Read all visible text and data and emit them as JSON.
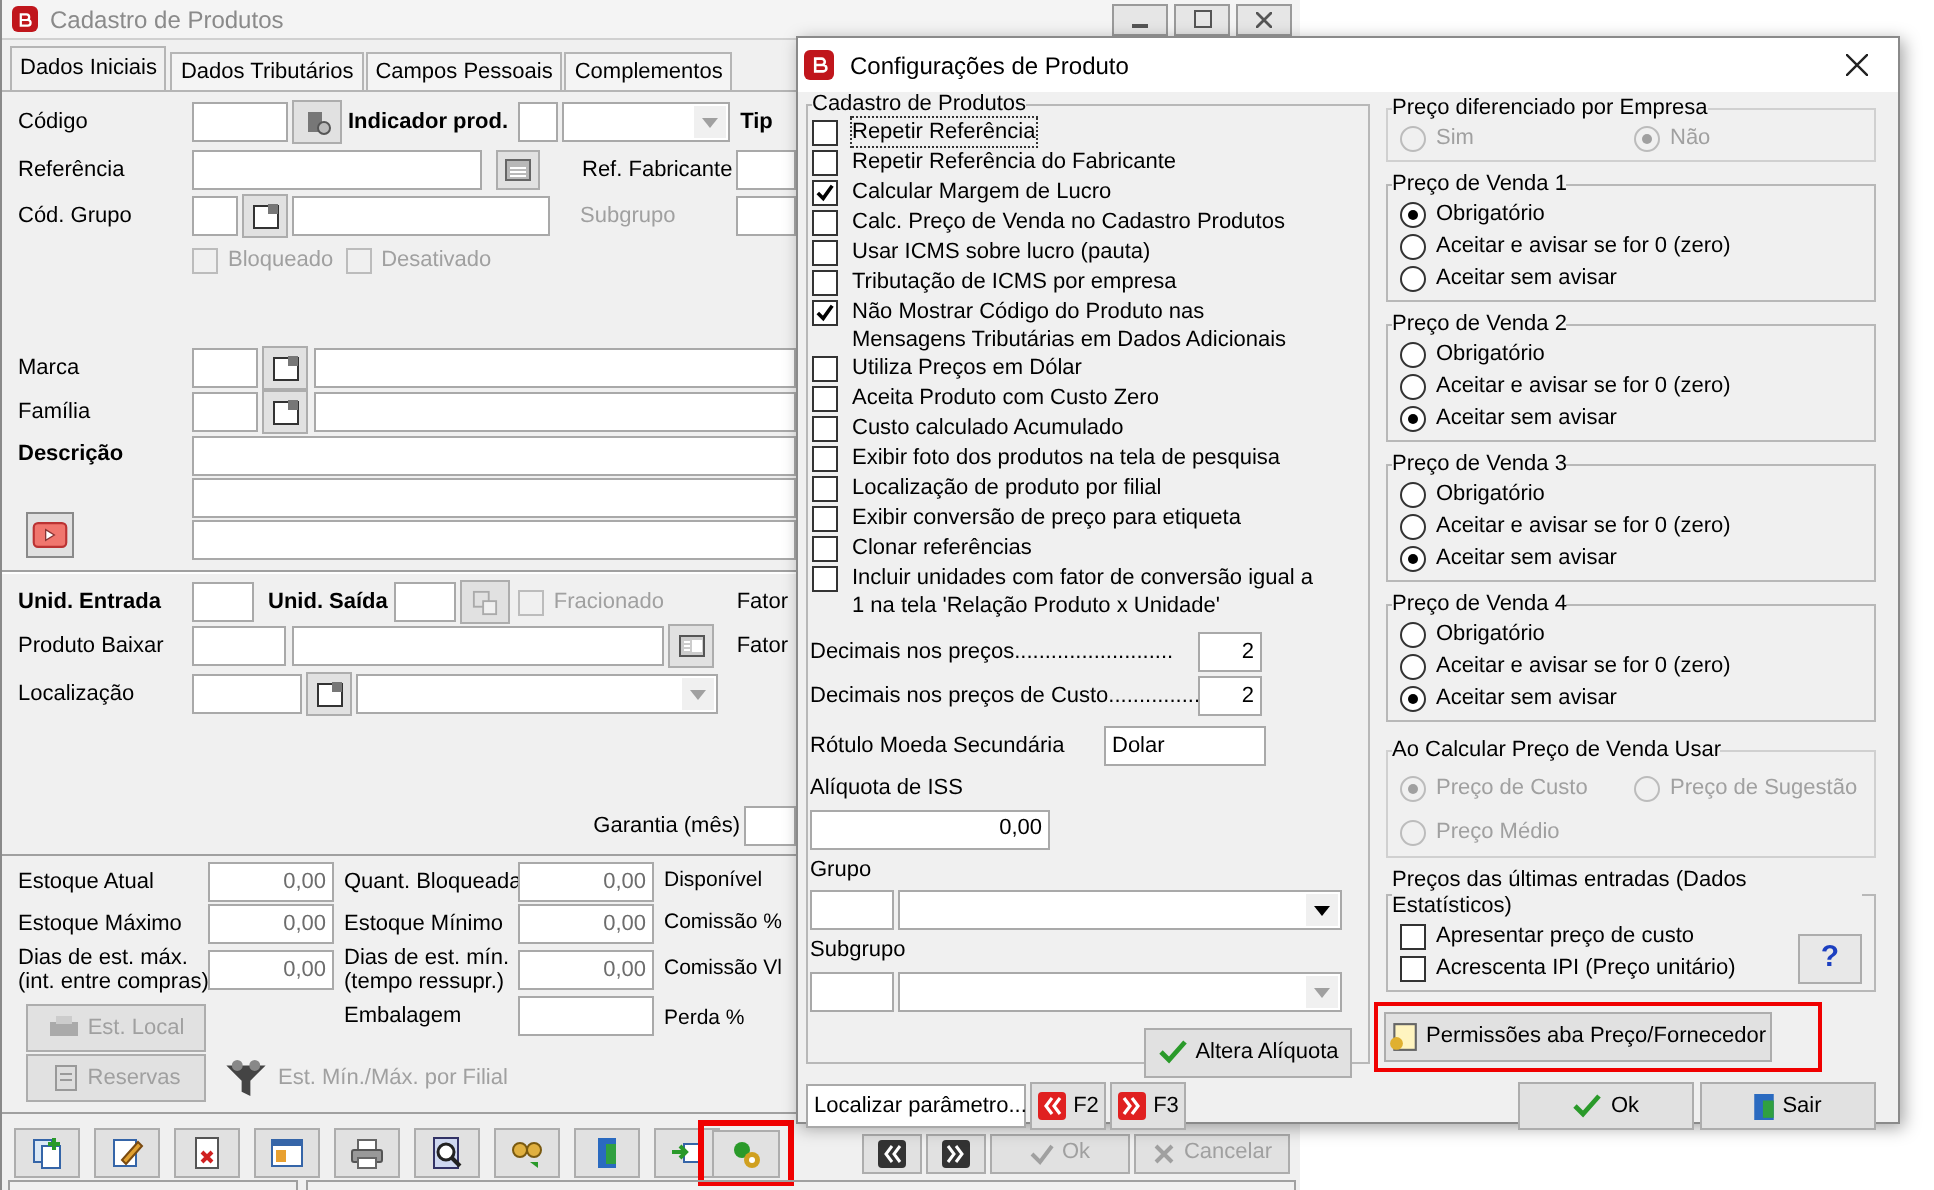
{
  "main_window": {
    "title": "Cadastro de Produtos",
    "tabs": [
      {
        "label": "Dados Iniciais",
        "selected": true
      },
      {
        "label": "Dados Tributários",
        "selected": false
      },
      {
        "label": "Campos Pessoais",
        "selected": false
      },
      {
        "label": "Complementos",
        "selected": false
      }
    ],
    "codigo_label": "Código",
    "indicador_label": "Indicador prod.",
    "tipo_label": "Tip",
    "referencia_label": "Referência",
    "ref_fabricante_label": "Ref. Fabricante",
    "cod_grupo_label": "Cód. Grupo",
    "subgrupo_label": "Subgrupo",
    "status_checks": [
      {
        "label": "Bloqueado",
        "checked": false,
        "disabled": true
      },
      {
        "label": "Desativado",
        "checked": false,
        "disabled": true
      }
    ],
    "marca_label": "Marca",
    "familia_label": "Família",
    "descricao_label": "Descrição",
    "unid_entrada_label": "Unid. Entrada",
    "unid_saida_label": "Unid. Saída",
    "fracionado": {
      "label": "Fracionado",
      "checked": false,
      "disabled": true
    },
    "fator_labels": [
      "Fator",
      "Fator"
    ],
    "produto_baixar_label": "Produto Baixar",
    "localizacao_label": "Localização",
    "garantia_label": "Garantia (mês)",
    "stock_rows": [
      {
        "kind": "values",
        "left_label": "Estoque Atual",
        "left_value": "0,00",
        "mid_label": "Quant. Bloqueada",
        "mid_value": "0,00",
        "right_label": "Disponível"
      },
      {
        "kind": "values",
        "left_label": "Estoque Máximo",
        "left_value": "0,00",
        "mid_label": "Estoque Mínimo",
        "mid_value": "0,00",
        "right_label": "Comissão %"
      },
      {
        "kind": "values",
        "left_label": "Dias de est. máx.\n(int. entre compras)",
        "left_value": "0,00",
        "mid_label": "Dias de est. mín.\n(tempo ressupr.)",
        "mid_value": "0,00",
        "right_label": "Comissão Vl"
      },
      {
        "kind": "button",
        "button": {
          "label": "Est. Local",
          "disabled": true
        },
        "mid_label": "Embalagem",
        "right_label": "Perda %"
      }
    ],
    "reservas_button": {
      "label": "Reservas",
      "disabled": true
    },
    "filial_link": {
      "label": "Est. Mín./Máx. por Filial",
      "disabled": true
    },
    "config_button": {
      "highlighted": true
    },
    "nav_buttons": [
      {
        "label": "Ok",
        "disabled": true
      },
      {
        "label": "Cancelar",
        "disabled": true
      }
    ]
  },
  "dialog": {
    "title": "Configurações de Produto",
    "cadastro_group": {
      "title": "Cadastro de Produtos",
      "options": [
        {
          "label": "Repetir Referência",
          "checked": false,
          "focused": true
        },
        {
          "label": "Repetir Referência do Fabricante",
          "checked": false,
          "focused": false
        },
        {
          "label": "Calcular Margem de Lucro",
          "checked": true,
          "focused": false
        },
        {
          "label": "Calc. Preço de Venda no Cadastro Produtos",
          "checked": false,
          "focused": false
        },
        {
          "label": "Usar ICMS sobre lucro (pauta)",
          "checked": false,
          "focused": false
        },
        {
          "label": "Tributação de ICMS por empresa",
          "checked": false,
          "focused": false
        },
        {
          "label": "Não Mostrar Código do Produto nas Mensagens Tributárias em Dados Adicionais",
          "checked": true,
          "focused": false
        },
        {
          "label": "Utiliza Preços em Dólar",
          "checked": false,
          "focused": false
        },
        {
          "label": "Aceita Produto com Custo Zero",
          "checked": false,
          "focused": false
        },
        {
          "label": "Custo calculado Acumulado",
          "checked": false,
          "focused": false
        },
        {
          "label": "Exibir foto dos produtos na tela de pesquisa",
          "checked": false,
          "focused": false
        },
        {
          "label": "Localização de produto por filial",
          "checked": false,
          "focused": false
        },
        {
          "label": "Exibir conversão de preço para etiqueta",
          "checked": false,
          "focused": false
        },
        {
          "label": "Clonar referências",
          "checked": false,
          "focused": false
        },
        {
          "label": "Incluir unidades com fator de conversão igual a 1 na tela 'Relação Produto x Unidade'",
          "checked": false,
          "focused": false
        }
      ]
    },
    "decimals": [
      {
        "label": "Decimais nos preços..........................",
        "value": "2"
      },
      {
        "label": "Decimais nos preços de Custo...............",
        "value": "2"
      }
    ],
    "moeda": {
      "label": "Rótulo Moeda Secundária",
      "value": "Dolar"
    },
    "iss": {
      "label": "Alíquota de ISS",
      "value": "0,00"
    },
    "grupo": {
      "label": "Grupo",
      "disabled": false
    },
    "subgrupo": {
      "label": "Subgrupo",
      "disabled": true
    },
    "altera_button": "Altera Alíquota"
  },
  "search": {
    "value": "Localizar parâmetro..."
  },
  "find_buttons": [
    {
      "label": "F2",
      "kind": "back"
    },
    {
      "label": "F3",
      "kind": "forward"
    }
  ],
  "price_company": {
    "title": "Preço diferenciado por Empresa",
    "disabled": true,
    "options": [
      {
        "label": "Sim",
        "selected": false
      },
      {
        "label": "Não",
        "selected": true
      }
    ]
  },
  "sale_prices": [
    {
      "title": "Preço de Venda 1",
      "options": [
        {
          "label": "Obrigatório",
          "selected": true
        },
        {
          "label": "Aceitar e avisar se for 0 (zero)",
          "selected": false
        },
        {
          "label": "Aceitar sem avisar",
          "selected": false
        }
      ]
    },
    {
      "title": "Preço de Venda 2",
      "options": [
        {
          "label": "Obrigatório",
          "selected": false
        },
        {
          "label": "Aceitar e avisar se for 0 (zero)",
          "selected": false
        },
        {
          "label": "Aceitar sem avisar",
          "selected": true
        }
      ]
    },
    {
      "title": "Preço de Venda 3",
      "options": [
        {
          "label": "Obrigatório",
          "selected": false
        },
        {
          "label": "Aceitar e avisar se for 0 (zero)",
          "selected": false
        },
        {
          "label": "Aceitar sem avisar",
          "selected": true
        }
      ]
    },
    {
      "title": "Preço de Venda 4",
      "options": [
        {
          "label": "Obrigatório",
          "selected": false
        },
        {
          "label": "Aceitar e avisar se for 0 (zero)",
          "selected": false
        },
        {
          "label": "Aceitar sem avisar",
          "selected": true
        }
      ]
    }
  ],
  "calc_group": {
    "title": "Ao Calcular Preço de Venda Usar",
    "disabled": true,
    "options": [
      {
        "label": "Preço de Custo",
        "selected": true
      },
      {
        "label": "Preço de Sugestão",
        "selected": false
      },
      {
        "label": "Preço Médio",
        "selected": false
      }
    ]
  },
  "stats_group": {
    "title": "Preços das últimas entradas (Dados Estatísticos)",
    "options": [
      {
        "label": "Apresentar preço de custo",
        "checked": false
      },
      {
        "label": "Acrescenta IPI (Preço unitário)",
        "checked": false
      }
    ],
    "help": "?"
  },
  "permissions_button": {
    "label": "Permissões aba Preço/Fornecedor",
    "highlighted": true
  },
  "footer_buttons": [
    {
      "label": "Ok",
      "kind": "ok"
    },
    {
      "label": "Sair",
      "kind": "exit"
    }
  ]
}
